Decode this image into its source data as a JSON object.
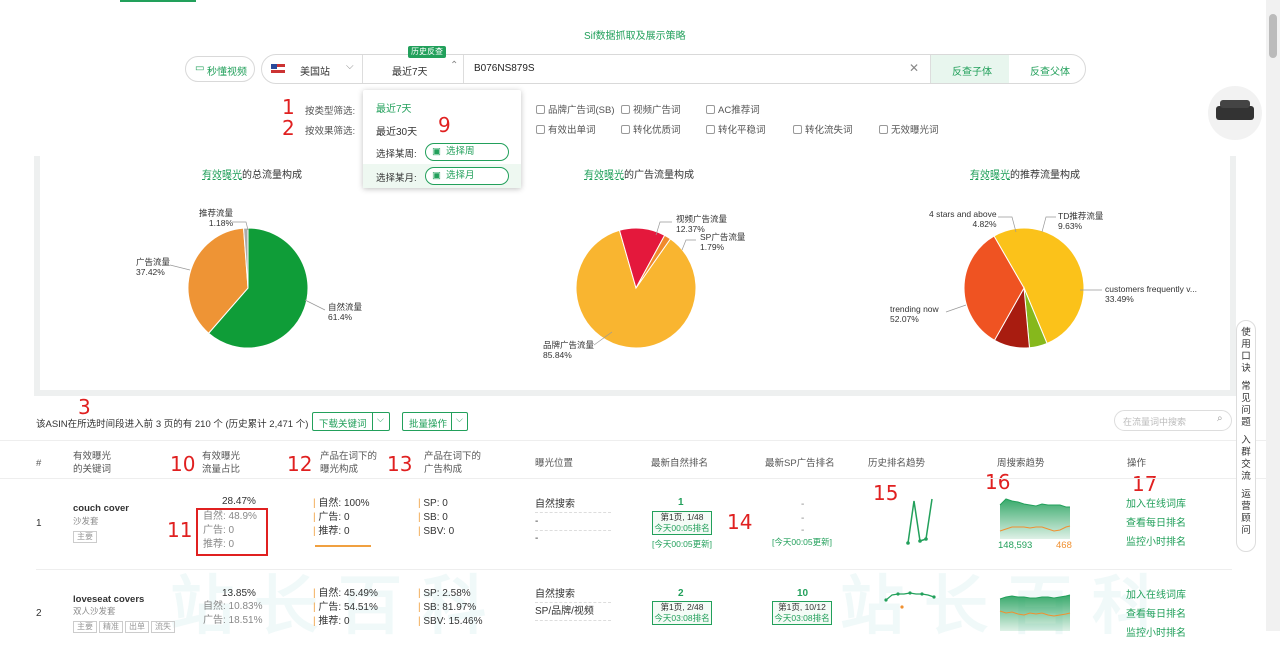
{
  "header": {
    "title": "Sif数据抓取及展示策略"
  },
  "toolbar": {
    "video_btn": "秒懂视频",
    "site": "美国站",
    "history_badge": "历史反查",
    "range": "最近7天",
    "asin_value": "B076NS879S",
    "child_btn": "反查子体",
    "parent_btn": "反查父体"
  },
  "filters": {
    "type_label": "按类型筛选:",
    "effect_label": "按效果筛选:",
    "type_opts": [
      "品牌广告词(SB)",
      "视频广告词",
      "AC推荐词"
    ],
    "effect_opts": [
      "有效出单词",
      "转化优质词",
      "转化平稳词",
      "转化流失词",
      "无效曝光词"
    ]
  },
  "dropdown": {
    "items": [
      "最近7天",
      "最近30天"
    ],
    "week_label": "选择某周:",
    "week_btn": "选择周",
    "month_label": "选择某月:",
    "month_btn": "选择月"
  },
  "pies": [
    {
      "title_link": "有效曝光",
      "title_rest": "的总流量构成",
      "labels": [
        {
          "name": "推荐流量",
          "pct": "1.18%"
        },
        {
          "name": "广告流量",
          "pct": "37.42%"
        },
        {
          "name": "自然流量",
          "pct": "61.4%"
        }
      ]
    },
    {
      "title_link": "有效曝光",
      "title_rest": "的广告流量构成",
      "labels": [
        {
          "name": "视频广告流量",
          "pct": "12.37%"
        },
        {
          "name": "SP广告流量",
          "pct": "1.79%"
        },
        {
          "name": "品牌广告流量",
          "pct": "85.84%"
        }
      ]
    },
    {
      "title_link": "有效曝光",
      "title_rest": "的推荐流量构成",
      "labels": [
        {
          "name": "4 stars and above",
          "pct": "4.82%"
        },
        {
          "name": "TD推荐流量",
          "pct": "9.63%"
        },
        {
          "name": "customers frequently v...",
          "pct": "33.49%"
        },
        {
          "name": "trending now",
          "pct": "52.07%"
        }
      ]
    }
  ],
  "chart_data": [
    {
      "type": "pie",
      "title": "有效曝光的总流量构成",
      "categories": [
        "自然流量",
        "广告流量",
        "推荐流量"
      ],
      "values": [
        61.4,
        37.42,
        1.18
      ],
      "colors": [
        "#0f9d38",
        "#ee9435",
        "#aaaaaa"
      ]
    },
    {
      "type": "pie",
      "title": "有效曝光的广告流量构成",
      "categories": [
        "品牌广告流量",
        "视频广告流量",
        "SP广告流量"
      ],
      "values": [
        85.84,
        12.37,
        1.79
      ],
      "colors": [
        "#f9b530",
        "#e4183c",
        "#f08a2c"
      ]
    },
    {
      "type": "pie",
      "title": "有效曝光的推荐流量构成",
      "categories": [
        "trending now",
        "4 stars and above",
        "TD推荐流量",
        "customers frequently v..."
      ],
      "values": [
        52.07,
        4.82,
        9.63,
        33.49
      ],
      "colors": [
        "#fbc21a",
        "#86b81c",
        "#a81c10",
        "#ef5322"
      ]
    }
  ],
  "summary": {
    "text": "该ASIN在所选时间段进入前 3 页的有 210 个 (历史累计 2,471 个)",
    "download_btn": "下载关键词",
    "batch_btn": "批量操作",
    "search_placeholder": "在流量词中搜索"
  },
  "table": {
    "headers": {
      "idx": "#",
      "kw": "有效曝光\n的关键词",
      "share": "有效曝光\n流量占比",
      "prod": "产品在词下的\n曝光构成",
      "ad": "产品在词下的\n广告构成",
      "pos": "曝光位置",
      "natural": "最新自然排名",
      "sp": "最新SP广告排名",
      "hist": "历史排名趋势",
      "week": "周搜索趋势",
      "op": "操作"
    },
    "rows": [
      {
        "idx": "1",
        "kw": "couch cover",
        "sub": "沙发套",
        "tags": [
          "主要"
        ],
        "share": "28.47%",
        "share_lines": [
          "自然: 48.9%",
          "广告: 0",
          "推荐: 0"
        ],
        "prod": [
          "自然: 100%",
          "广告: 0",
          "推荐: 0"
        ],
        "ad": [
          "SP: 0",
          "SB: 0",
          "SBV: 0"
        ],
        "pos": [
          "自然搜索",
          "-",
          "-"
        ],
        "nat_rank": "1",
        "nat_box": [
          "第1页, 1/48",
          "今天00:05排名"
        ],
        "nat_update": "[今天00:05更新]",
        "sp_rank": [
          "-",
          "-",
          "-"
        ],
        "sp_update": "[今天00:05更新]",
        "week_left": "148,593",
        "week_right": "468",
        "ops": [
          "加入在线词库",
          "查看每日排名",
          "监控小时排名"
        ]
      },
      {
        "idx": "2",
        "kw": "loveseat covers",
        "sub": "双人沙发套",
        "tags": [
          "主要",
          "精准",
          "出单",
          "流失"
        ],
        "share": "13.85%",
        "share_lines": [
          "自然: 10.83%",
          "广告: 18.51%"
        ],
        "prod": [
          "自然: 45.49%",
          "广告: 54.51%",
          "推荐: 0"
        ],
        "ad": [
          "SP: 2.58%",
          "SB: 81.97%",
          "SBV: 15.46%"
        ],
        "pos": [
          "自然搜索",
          "SP/品牌/视频"
        ],
        "nat_rank": "2",
        "nat_box": [
          "第1页, 2/48",
          "今天03:08排名"
        ],
        "sp_rank_num": "10",
        "sp_box": [
          "第1页, 10/12",
          "今天03:08排名"
        ],
        "ops": [
          "加入在线词库",
          "查看每日排名",
          "监控小时排名"
        ]
      }
    ]
  },
  "annotations": [
    "1",
    "2",
    "3",
    "9",
    "10",
    "11",
    "12",
    "13",
    "14",
    "15",
    "16",
    "17"
  ],
  "sidebar": {
    "items": [
      "使用口诀",
      "常见问题",
      "入群交流",
      "运营顾问"
    ]
  }
}
